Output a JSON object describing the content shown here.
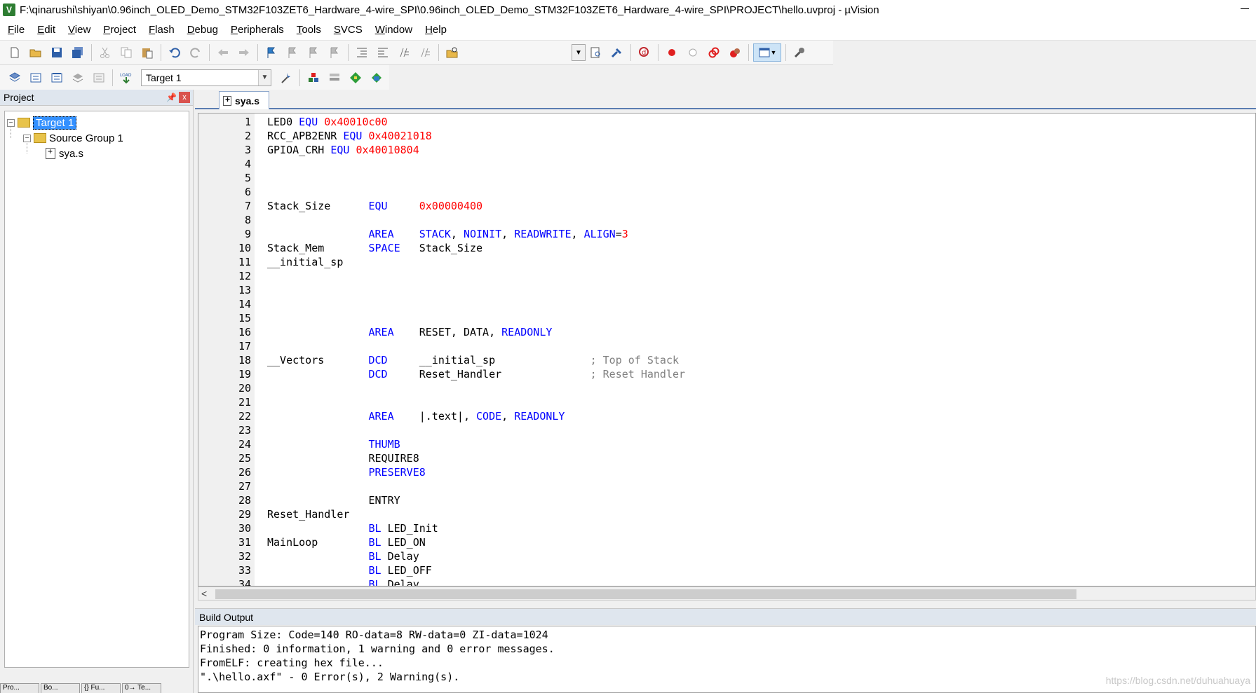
{
  "window": {
    "title": "F:\\qinarushi\\shiyan\\0.96inch_OLED_Demo_STM32F103ZET6_Hardware_4-wire_SPI\\0.96inch_OLED_Demo_STM32F103ZET6_Hardware_4-wire_SPI\\PROJECT\\hello.uvproj - µVision",
    "app_icon_glyph": "V"
  },
  "menu": [
    "File",
    "Edit",
    "View",
    "Project",
    "Flash",
    "Debug",
    "Peripherals",
    "Tools",
    "SVCS",
    "Window",
    "Help"
  ],
  "toolbar1": {
    "icons": [
      "new-file-icon",
      "open-file-icon",
      "save-icon",
      "save-all-icon",
      "cut-icon",
      "copy-icon",
      "paste-icon",
      "undo-icon",
      "redo-icon",
      "nav-back-icon",
      "nav-forward-icon",
      "bookmark-icon",
      "prev-bookmark-icon",
      "next-bookmark-icon",
      "clear-bookmarks-icon",
      "indent-icon",
      "unindent-icon",
      "comment-icon",
      "uncomment-icon",
      "find-in-files-icon",
      "find-combo",
      "find-icon",
      "incremental-find-icon",
      "debug-session-icon",
      "breakpoint-icon",
      "disable-breakpoint-icon",
      "disable-all-breakpoints-icon",
      "kill-breakpoints-icon",
      "window-layout-icon",
      "configure-icon"
    ]
  },
  "toolbar2": {
    "target_name": "Target 1",
    "icons": [
      "translate-icon",
      "build-icon",
      "rebuild-icon",
      "batch-build-icon",
      "stop-build-icon",
      "download-icon",
      "target-options-icon",
      "manage-components-icon",
      "select-packs-icon",
      "pack-installer-icon",
      "runtime-env-icon"
    ],
    "load_label": "LOAD"
  },
  "project_panel": {
    "title": "Project",
    "pin": "p",
    "close": "x",
    "tree": {
      "target": "Target 1",
      "group": "Source Group 1",
      "file": "sya.s"
    },
    "bottom_tabs": [
      "Pro...",
      "Bo...",
      "{} Fu...",
      "0→ Te..."
    ]
  },
  "editor": {
    "tab": "sya.s",
    "lines": [
      [
        [
          "t",
          "LED0 "
        ],
        [
          "k",
          "EQU"
        ],
        [
          "t",
          " "
        ],
        [
          "n",
          "0x40010c00"
        ]
      ],
      [
        [
          "t",
          "RCC_APB2ENR "
        ],
        [
          "k",
          "EQU"
        ],
        [
          "t",
          " "
        ],
        [
          "n",
          "0x40021018"
        ]
      ],
      [
        [
          "t",
          "GPIOA_CRH "
        ],
        [
          "k",
          "EQU"
        ],
        [
          "t",
          " "
        ],
        [
          "n",
          "0x40010804"
        ]
      ],
      [],
      [],
      [],
      [
        [
          "t",
          "Stack_Size      "
        ],
        [
          "k",
          "EQU"
        ],
        [
          "t",
          "     "
        ],
        [
          "n",
          "0x00000400"
        ]
      ],
      [],
      [
        [
          "t",
          "                "
        ],
        [
          "k",
          "AREA"
        ],
        [
          "t",
          "    "
        ],
        [
          "k",
          "STACK"
        ],
        [
          "t",
          ", "
        ],
        [
          "k",
          "NOINIT"
        ],
        [
          "t",
          ", "
        ],
        [
          "k",
          "READWRITE"
        ],
        [
          "t",
          ", "
        ],
        [
          "k",
          "ALIGN"
        ],
        [
          "t",
          "="
        ],
        [
          "n",
          "3"
        ]
      ],
      [
        [
          "t",
          "Stack_Mem       "
        ],
        [
          "k",
          "SPACE"
        ],
        [
          "t",
          "   Stack_Size"
        ]
      ],
      [
        [
          "t",
          "__initial_sp"
        ]
      ],
      [],
      [],
      [],
      [],
      [
        [
          "t",
          "                "
        ],
        [
          "k",
          "AREA"
        ],
        [
          "t",
          "    RESET, DATA, "
        ],
        [
          "k",
          "READONLY"
        ]
      ],
      [],
      [
        [
          "t",
          "__Vectors       "
        ],
        [
          "k",
          "DCD"
        ],
        [
          "t",
          "     __initial_sp               "
        ],
        [
          "c",
          "; Top of Stack"
        ]
      ],
      [
        [
          "t",
          "                "
        ],
        [
          "k",
          "DCD"
        ],
        [
          "t",
          "     Reset_Handler              "
        ],
        [
          "c",
          "; Reset Handler"
        ]
      ],
      [],
      [],
      [
        [
          "t",
          "                "
        ],
        [
          "k",
          "AREA"
        ],
        [
          "t",
          "    |.text|, "
        ],
        [
          "k",
          "CODE"
        ],
        [
          "t",
          ", "
        ],
        [
          "k",
          "READONLY"
        ]
      ],
      [],
      [
        [
          "t",
          "                "
        ],
        [
          "k",
          "THUMB"
        ]
      ],
      [
        [
          "t",
          "                REQUIRE8"
        ]
      ],
      [
        [
          "t",
          "                "
        ],
        [
          "k",
          "PRESERVE8"
        ]
      ],
      [],
      [
        [
          "t",
          "                ENTRY"
        ]
      ],
      [
        [
          "t",
          "Reset_Handler"
        ]
      ],
      [
        [
          "t",
          "                "
        ],
        [
          "k",
          "BL"
        ],
        [
          "t",
          " LED_Init"
        ]
      ],
      [
        [
          "t",
          "MainLoop        "
        ],
        [
          "k",
          "BL"
        ],
        [
          "t",
          " LED_ON"
        ]
      ],
      [
        [
          "t",
          "                "
        ],
        [
          "k",
          "BL"
        ],
        [
          "t",
          " Delay"
        ]
      ],
      [
        [
          "t",
          "                "
        ],
        [
          "k",
          "BL"
        ],
        [
          "t",
          " LED_OFF"
        ]
      ],
      [
        [
          "t",
          "                "
        ],
        [
          "k",
          "BL"
        ],
        [
          "t",
          " Delay"
        ]
      ]
    ],
    "line_numbers": [
      "1",
      "2",
      "3",
      "4",
      "5",
      "6",
      "7",
      "8",
      "9",
      "10",
      "11",
      "12",
      "13",
      "14",
      "15",
      "16",
      "17",
      "18",
      "19",
      "20",
      "21",
      "22",
      "23",
      "24",
      "25",
      "26",
      "27",
      "28",
      "29",
      "30",
      "31",
      "32",
      "33",
      "34"
    ],
    "scroll_arrow": "<"
  },
  "build_output": {
    "title": "Build Output",
    "lines": [
      "Program Size: Code=140 RO-data=8 RW-data=0 ZI-data=1024",
      "Finished: 0 information, 1 warning and 0 error messages.",
      "FromELF: creating hex file...",
      "\".\\hello.axf\" - 0 Error(s), 2 Warning(s)."
    ]
  },
  "watermark": "https://blog.csdn.net/duhuahuaya",
  "colors": {
    "keyword": "#0000ff",
    "number": "#ff0000",
    "comment": "#808080",
    "selection": "#3390ff"
  }
}
